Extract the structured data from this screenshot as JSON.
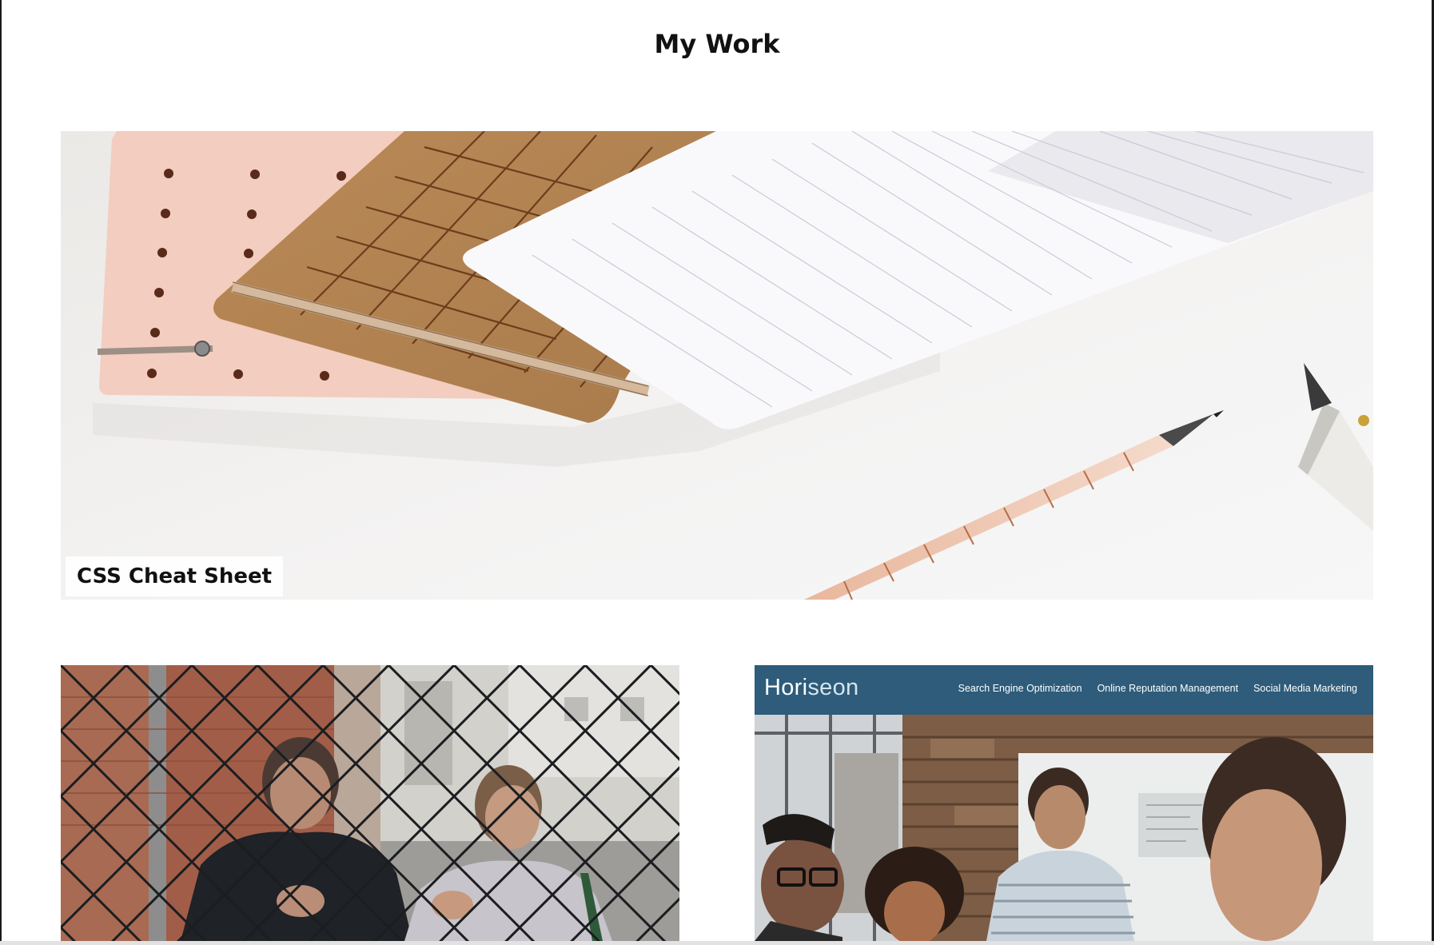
{
  "section": {
    "title": "My Work"
  },
  "projects": [
    {
      "caption": "CSS Cheat Sheet",
      "image_icon": "notebooks-and-pens-photo"
    },
    {
      "image_icon": "people-behind-fence-photo"
    },
    {
      "image_icon": "horiseon-website-screenshot",
      "mock_site": {
        "logo_bold": "Hori",
        "logo_light": "seon",
        "nav": [
          "Search Engine Optimization",
          "Online Reputation Management",
          "Social Media Marketing"
        ],
        "header_color": "#2e5c7a"
      }
    }
  ],
  "colors": {
    "background": "#ffffff",
    "text": "#111111"
  }
}
